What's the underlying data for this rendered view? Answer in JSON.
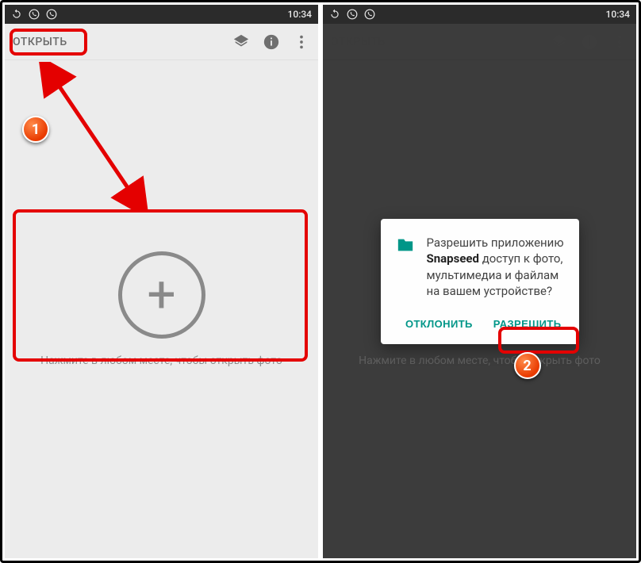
{
  "status": {
    "time": "10:34"
  },
  "toolbar": {
    "open_label": "ОТКРЫТЬ"
  },
  "main": {
    "hint": "Нажмите в любом месте, чтобы открыть фото"
  },
  "dialog": {
    "text_prefix": "Разрешить приложению ",
    "app_name": "Snapseed",
    "text_suffix": " доступ к фото, мультимедиа и файлам на вашем устройстве?",
    "deny_label": "ОТКЛОНИТЬ",
    "allow_label": "РАЗРЕШИТЬ"
  },
  "annotations": {
    "step1": "1",
    "step2": "2"
  },
  "colors": {
    "accent": "#009688",
    "highlight": "#e40000",
    "badge": "#e93b00"
  }
}
